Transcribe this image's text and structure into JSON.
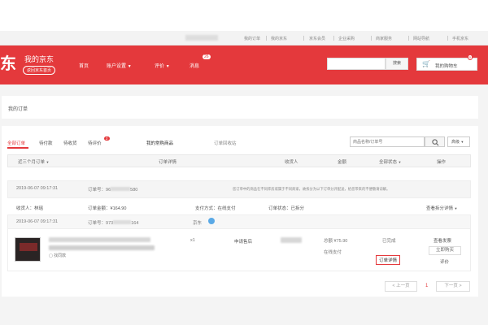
{
  "topbar": {
    "links": [
      "我的订单",
      "我的京东",
      "京东会员",
      "企业采购",
      "商家服务",
      "网站导航",
      "手机京东"
    ]
  },
  "header": {
    "logo_char": "东",
    "title": "我的京东",
    "back_home": "返回京东首页",
    "nav": [
      "首页",
      "账户设置",
      "评价",
      "消息"
    ],
    "message_count": "26",
    "search_button": "搜索",
    "cart_label": "我的购物车",
    "cart_count": "0"
  },
  "page_title": "我的订单",
  "tabs": {
    "all": "全部订单",
    "pending_pay": "待付款",
    "pending_receive": "待收货",
    "pending_review": "待评价",
    "pending_review_count": "2",
    "shopping_assistant": "我的常购商品",
    "recycle": "订单回收站",
    "search_placeholder": "商品名称/订单号",
    "search_icon": "search-icon",
    "advanced": "高级"
  },
  "table_header": {
    "period": "近三个月订单",
    "details": "订单详情",
    "receiver": "收货人",
    "amount": "金额",
    "status": "全部状态",
    "action": "操作"
  },
  "orders": [
    {
      "time": "2019-06-07 09:17:31",
      "order_label": "订单号：",
      "order_no": "96",
      "order_no_tail": "580",
      "notice": "您订单中的商品在不同库房或属于不同商家，故拆分为以下订单分开配送，给您带来的不便敬请谅解。",
      "receiver_label": "收货人：林瑶",
      "amount_label": "订单金额：",
      "amount": "¥164.90",
      "pay_method": "支付方式：在线支付",
      "status": "订单状态：已拆分",
      "view_split": "查看拆分详情"
    },
    {
      "time": "2019-06-07 09:17:31",
      "order_label": "订单号：",
      "order_no": "973",
      "order_no_tail": "164",
      "shop": "京东",
      "item_note": "找同款",
      "quantity": "x1",
      "service": "申请售后",
      "total_label": "总额",
      "total": "¥75.90",
      "pay": "在线支付",
      "state": "已完成",
      "detail_link": "订单详情",
      "view_invoice": "查看发票",
      "buy_again": "立即购买",
      "review": "评价"
    }
  ],
  "pagination": {
    "prev": "< 上一页",
    "current": "1",
    "next": "下一页 >"
  },
  "colors": {
    "brand": "#e4393c",
    "background": "#f4f4f4"
  }
}
